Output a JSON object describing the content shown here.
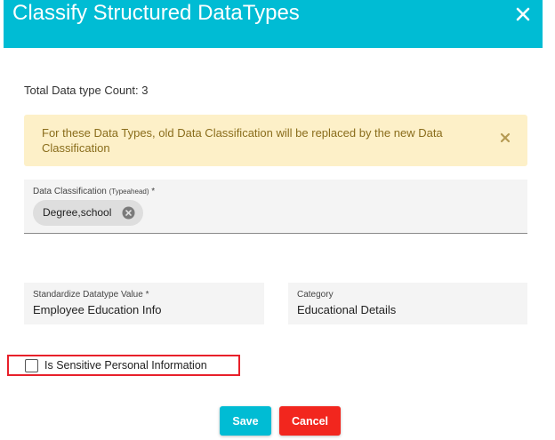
{
  "dialog": {
    "title": "Classify Structured DataTypes",
    "count_label": "Total Data type Count: 3"
  },
  "alert": {
    "message": "For these Data Types, old Data Classification will be replaced by the new Data Classification"
  },
  "classification": {
    "label": "Data Classification",
    "hint": "(Typeahead)",
    "required_mark": " *",
    "chips": [
      {
        "label": "Degree,school"
      }
    ]
  },
  "standardize": {
    "label": "Standardize Datatype Value *",
    "value": "Employee Education Info"
  },
  "category": {
    "label": "Category",
    "value": "Educational Details"
  },
  "sensitive": {
    "label": "Is Sensitive Personal Information",
    "checked": false
  },
  "buttons": {
    "save_label": "Save",
    "cancel_label": "Cancel"
  },
  "colors": {
    "header": "#00bcd4",
    "alert_bg": "#fdf0c8",
    "alert_text": "#8a6d1c",
    "save": "#00bcd4",
    "cancel": "#f2261e",
    "highlight_border": "#e8202a"
  },
  "icons": {
    "dialog_close": "close-icon",
    "alert_close": "close-icon",
    "chip_remove": "remove-circle-icon"
  }
}
